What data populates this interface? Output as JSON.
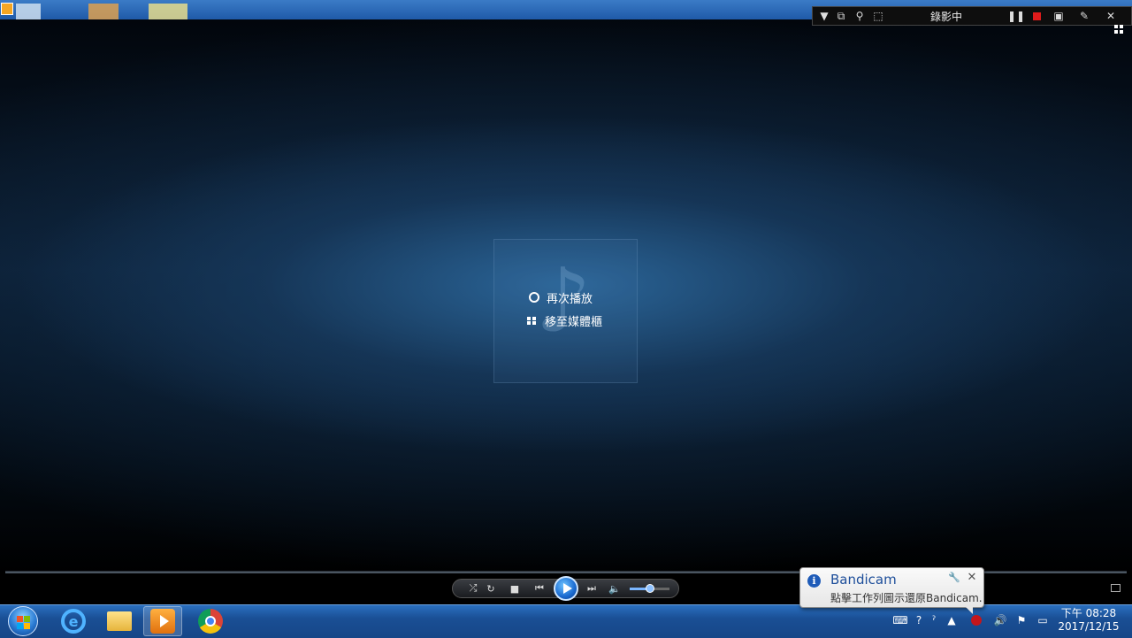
{
  "player": {
    "menu_items": [
      {
        "label": "再次播放",
        "icon": "replay-ring-icon"
      },
      {
        "label": "移至媒體櫃",
        "icon": "library-grid-icon"
      }
    ],
    "background_icon": "music-note-icon",
    "note_glyph": "♪",
    "volume_level": 0.5
  },
  "bandicam_bar": {
    "status": "錄影中",
    "icons": [
      "dropdown-icon",
      "window-mode-icon",
      "search-icon",
      "screen-select-icon",
      "pause-icon",
      "stop-icon",
      "camera-icon",
      "pencil-icon",
      "close-icon"
    ]
  },
  "notification": {
    "title": "Bandicam",
    "message": "點擊工作列圖示還原Bandicam."
  },
  "taskbar": {
    "apps": [
      "internet-explorer-icon",
      "file-explorer-icon",
      "windows-media-player-icon",
      "chrome-icon"
    ],
    "clock_time": "下午 08:28",
    "clock_date": "2017/12/15"
  },
  "colors": {
    "accent": "#1a6ad0",
    "record_red": "#e01b1b",
    "taskbar": "#1a4f95"
  }
}
